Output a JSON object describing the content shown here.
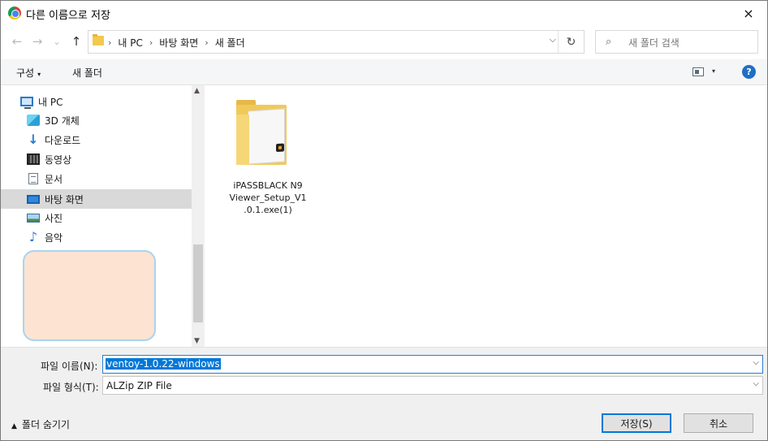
{
  "window": {
    "title": "다른 이름으로 저장",
    "close_icon": "×"
  },
  "nav": {
    "back_icon": "←",
    "forward_icon": "→",
    "recent_icon": "⌄",
    "up_icon": "↑"
  },
  "address": {
    "crumbs": [
      "내 PC",
      "바탕 화면",
      "새 폴더"
    ],
    "separator": "›",
    "dropdown_icon": "⌵",
    "refresh_icon": "↻"
  },
  "search": {
    "placeholder": "새 폴더 검색",
    "icon": "⌕"
  },
  "toolbar": {
    "organize_label": "구성",
    "caret": "▾",
    "new_folder_label": "새 폴더",
    "help_label": "?"
  },
  "sidebar": {
    "items": [
      {
        "label": "내 PC",
        "icon": "pc-icon"
      },
      {
        "label": "3D 개체",
        "icon": "cube-3d-icon"
      },
      {
        "label": "다운로드",
        "icon": "download-icon"
      },
      {
        "label": "동영상",
        "icon": "video-icon"
      },
      {
        "label": "문서",
        "icon": "document-icon"
      },
      {
        "label": "바탕 화면",
        "icon": "desktop-icon",
        "selected": true
      },
      {
        "label": "사진",
        "icon": "picture-icon"
      },
      {
        "label": "음악",
        "icon": "music-icon"
      }
    ],
    "scroll_up": "▲",
    "scroll_down": "▼"
  },
  "files": [
    {
      "name": "iPASSBLACK N9 Viewer_Setup_V1.0.1.exe(1)",
      "line1": "iPASSBLACK N9",
      "line2": "Viewer_Setup_V1",
      "line3": ".0.1.exe(1)",
      "icon": "folder-with-exe-icon"
    }
  ],
  "form": {
    "filename_label": "파일 이름(N):",
    "filename_value": "ventoy-1.0.22-windows",
    "filetype_label": "파일 형식(T):",
    "filetype_value": "ALZip ZIP File",
    "dropdown_icon": "⌵",
    "hide_folders_label": "폴더 숨기기",
    "hide_caret": "▲",
    "save_label": "저장(S)",
    "cancel_label": "취소"
  },
  "colors": {
    "accent": "#0078d7",
    "selection": "#d9d9d9",
    "highlight_box": "#fde3d2"
  }
}
